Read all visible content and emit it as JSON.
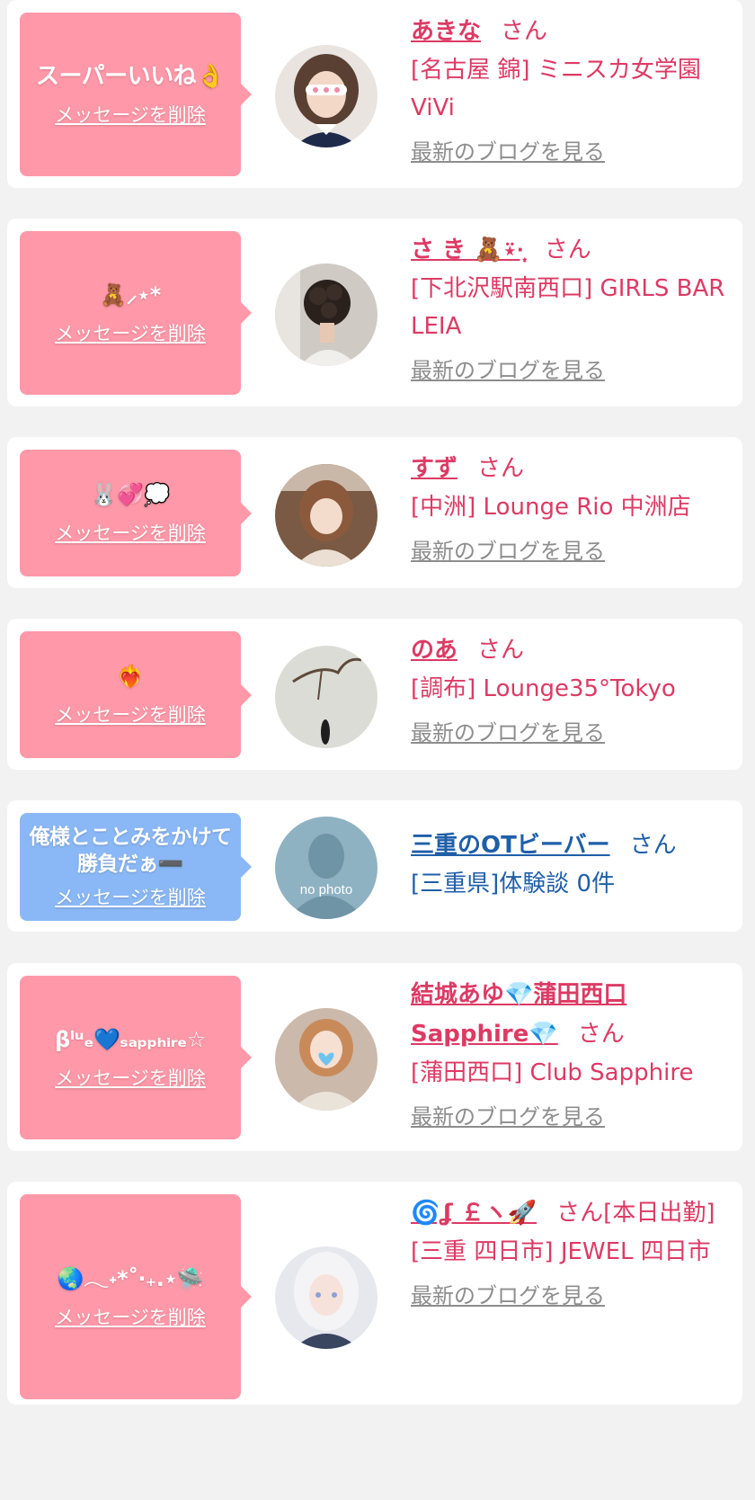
{
  "common": {
    "delete_label": "メッセージを削除",
    "blog_label": "最新のブログを見る",
    "honorific": "さん"
  },
  "colors": {
    "page_bg": "#f2f2f2",
    "bubble_pink": "#ff98a8",
    "bubble_blue": "#8ab8f6",
    "name_pink": "#dd3a64",
    "name_blue": "#1f5fa8",
    "blog_gray": "#8d8d8d"
  },
  "entries": [
    {
      "stamp": "スーパーいいね👌",
      "name": "あきな",
      "shop": "[名古屋 錦] ミニスカ女学園ViVi",
      "avatar_icon": "girl-photo-avatar",
      "has_blog": true
    },
    {
      "stamp": "🧸⸝⋆*",
      "name": "さ き 🧸⍣·̩͙",
      "shop": "[下北沢駅南西口] GIRLS BAR LEIA",
      "avatar_icon": "hair-back-photo-avatar",
      "has_blog": true
    },
    {
      "stamp": "🐰💞💭",
      "name": "すず",
      "shop": "[中洲] Lounge Rio 中洲店",
      "avatar_icon": "girl-photo-avatar",
      "has_blog": true
    },
    {
      "stamp": "❤️‍🔥",
      "name": "のあ",
      "shop": "[調布] Lounge35°Tokyo",
      "avatar_icon": "branch-photo-avatar",
      "has_blog": true
    },
    {
      "stamp": "俺様とことみをかけて勝負だぁ➖",
      "name": "三重のOTビーバー",
      "shop": "[三重県]体験談 0件",
      "avatar_icon": "no-photo-avatar",
      "no_photo_label": "no photo",
      "has_blog": false
    },
    {
      "stamp": "βˡᵘₑ💙ₛₐₚₚₕᵢᵣₑ☆",
      "name": "結城あゆ💎蒲田西口Sapphire💎",
      "shop": "[蒲田西口] Club Sapphire",
      "avatar_icon": "girl-photo-avatar",
      "has_blog": true
    },
    {
      "stamp": "🌏𓂃˖*˚‧₊.⋆🛸",
      "name": "🌀ʆ ￡ヽ🚀",
      "shop": "[三重 四日市] JEWEL 四日市",
      "status": "[本日出勤]",
      "avatar_icon": "girl-photo-avatar",
      "has_blog": true
    }
  ]
}
